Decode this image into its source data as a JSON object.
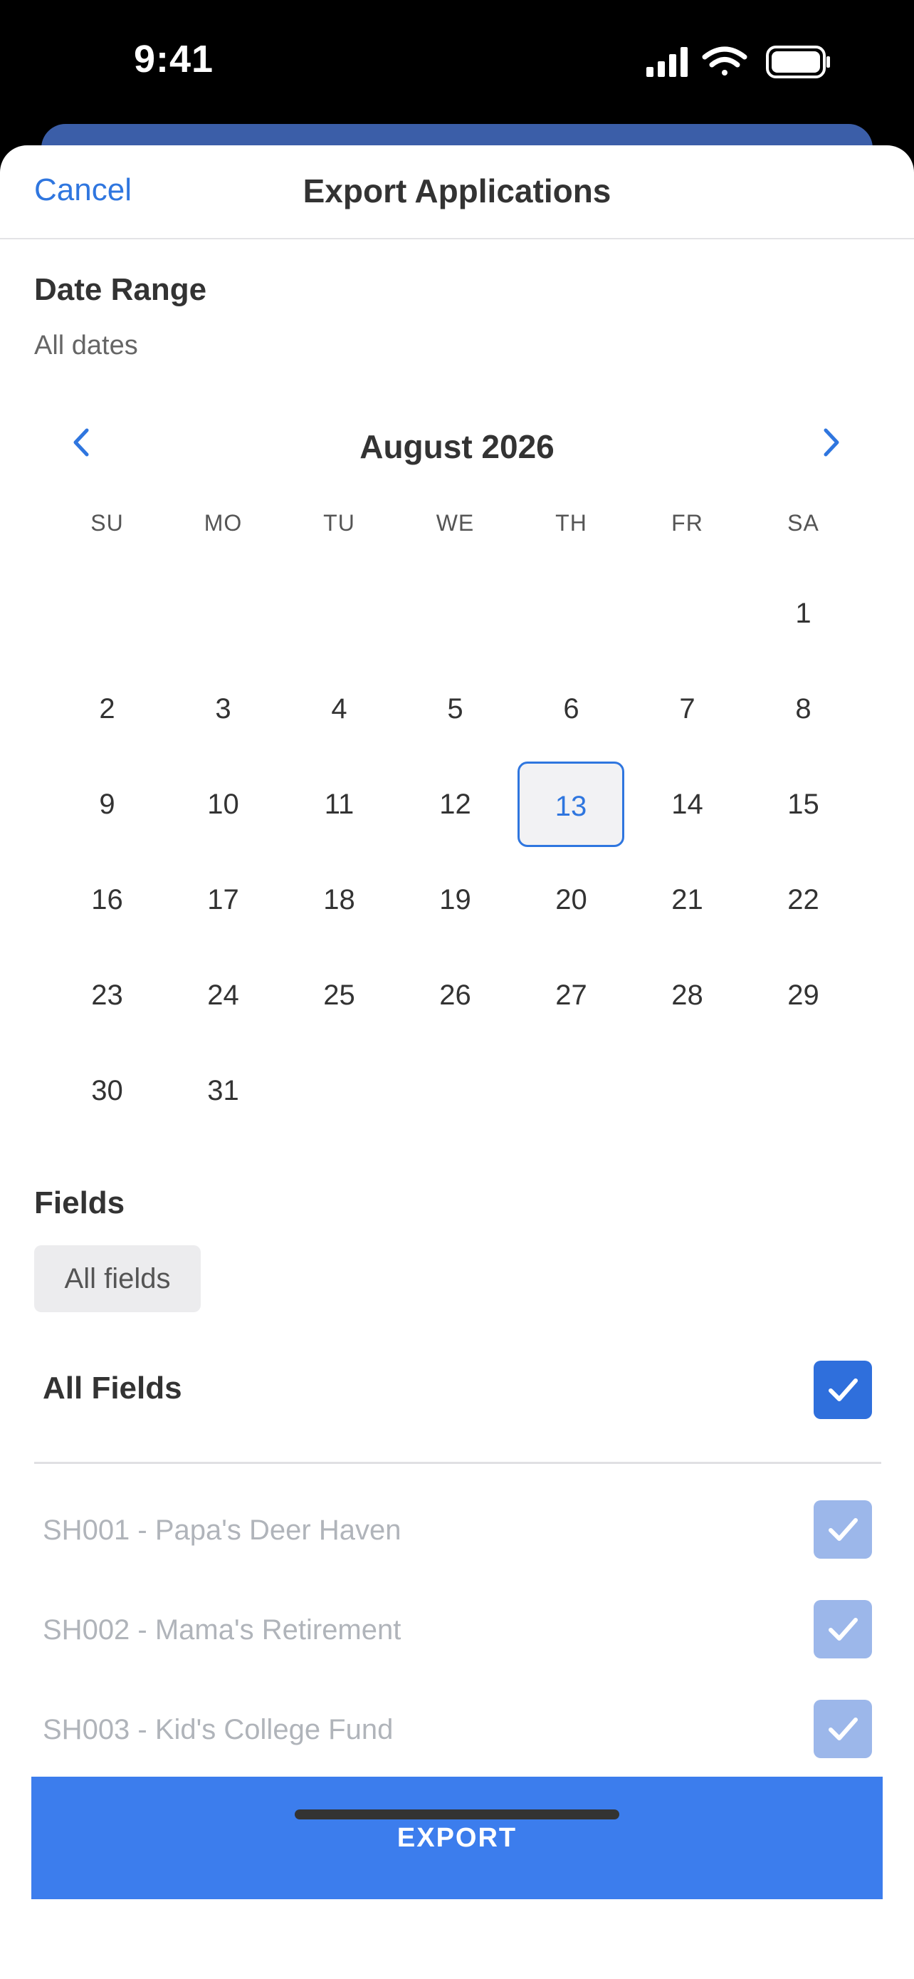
{
  "status_bar": {
    "time": "9:41"
  },
  "header": {
    "cancel_label": "Cancel",
    "title": "Export Applications"
  },
  "date_range": {
    "label": "Date Range",
    "value": "All dates"
  },
  "calendar": {
    "month_label": "August 2026",
    "weekdays": [
      "SU",
      "MO",
      "TU",
      "WE",
      "TH",
      "FR",
      "SA"
    ],
    "weeks": [
      [
        "",
        "",
        "",
        "",
        "",
        "",
        "1"
      ],
      [
        "2",
        "3",
        "4",
        "5",
        "6",
        "7",
        "8"
      ],
      [
        "9",
        "10",
        "11",
        "12",
        "13",
        "14",
        "15"
      ],
      [
        "16",
        "17",
        "18",
        "19",
        "20",
        "21",
        "22"
      ],
      [
        "23",
        "24",
        "25",
        "26",
        "27",
        "28",
        "29"
      ],
      [
        "30",
        "31",
        "",
        "",
        "",
        "",
        ""
      ]
    ],
    "selected_day": "13"
  },
  "fields": {
    "label": "Fields",
    "chip_label": "All fields",
    "all_fields_label": "All Fields",
    "all_fields_checked": true,
    "items": [
      {
        "label": "SH001 - Papa's Deer Haven",
        "checked": true
      },
      {
        "label": "SH002 - Mama's Retirement",
        "checked": true
      },
      {
        "label": "SH003 - Kid's College Fund",
        "checked": true
      }
    ]
  },
  "export_button": {
    "label": "EXPORT"
  },
  "colors": {
    "accent": "#2f76df",
    "button": "#3c7ded",
    "checkbox_disabled": "#9cb7ea"
  }
}
